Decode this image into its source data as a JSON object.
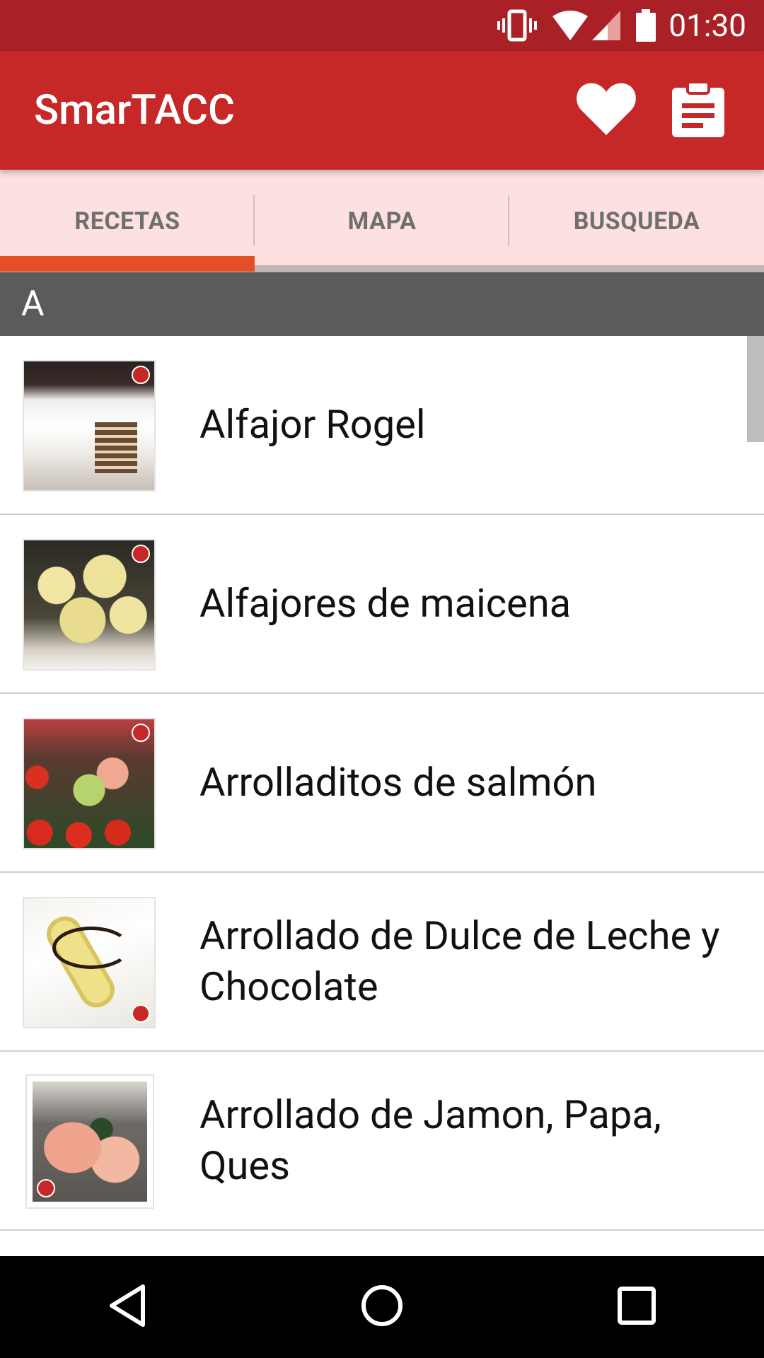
{
  "status_bar": {
    "time": "01:30"
  },
  "app_bar": {
    "title": "SmarTACC"
  },
  "tabs": [
    {
      "label": "RECETAS",
      "selected": true
    },
    {
      "label": "MAPA",
      "selected": false
    },
    {
      "label": "BUSQUEDA",
      "selected": false
    }
  ],
  "section": {
    "letter": "A"
  },
  "recipes": [
    {
      "title": "Alfajor Rogel"
    },
    {
      "title": "Alfajores de maicena"
    },
    {
      "title": "Arrolladitos de salmón"
    },
    {
      "title": "Arrollado de Dulce de Leche y Chocolate"
    },
    {
      "title": "Arrollado de Jamon, Papa, Ques"
    }
  ],
  "colors": {
    "primary": "#c62828",
    "primary_dark": "#a92126",
    "accent": "#e35027",
    "tab_bg": "#fde0e0",
    "section_bg": "#5b5b5b"
  },
  "icons": {
    "status": [
      "vibrate-icon",
      "wifi-icon",
      "signal-icon",
      "battery-icon"
    ],
    "actions": [
      "heart-icon",
      "clipboard-icon"
    ],
    "nav": [
      "back-icon",
      "home-icon",
      "recents-icon"
    ]
  }
}
